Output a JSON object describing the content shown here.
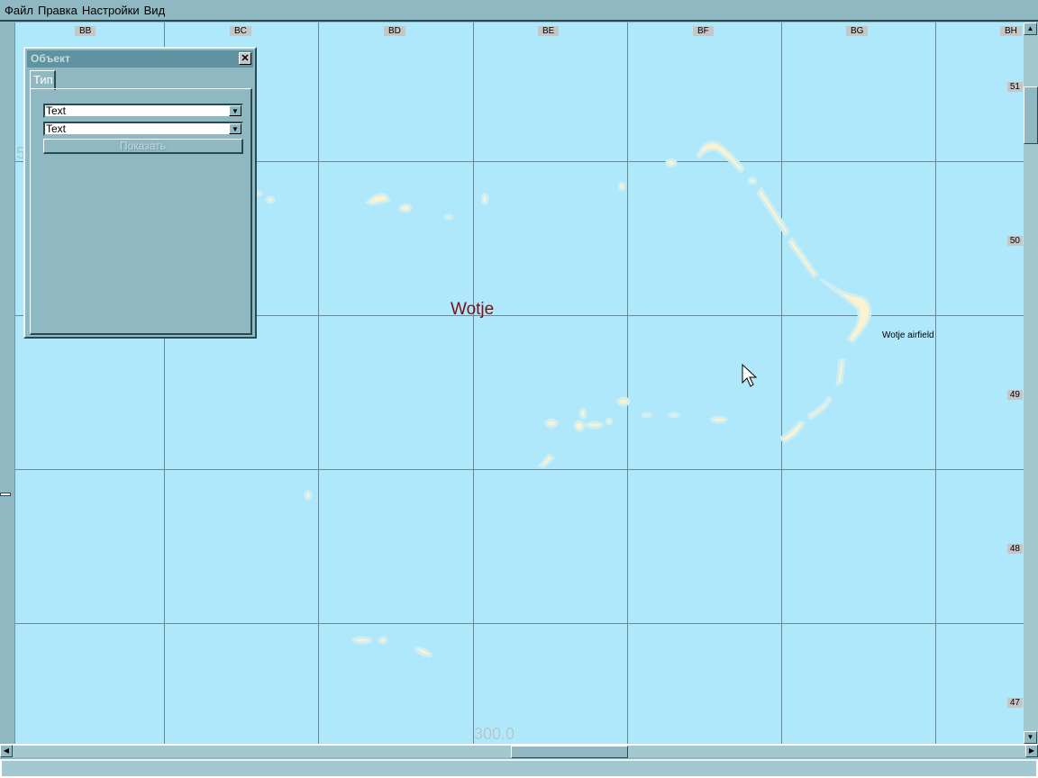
{
  "menu": [
    "Файл",
    "Правка",
    "Настройки",
    "Вид"
  ],
  "map": {
    "columns": [
      "BB",
      "BC",
      "BD",
      "BE",
      "BF",
      "BG",
      "BH"
    ],
    "rows": [
      "51",
      "50",
      "49",
      "48",
      "47"
    ],
    "labels": {
      "atoll": "Wotje",
      "airfield": "Wotje airfield",
      "scale": "300.0",
      "edge_digit": "5"
    }
  },
  "dialog": {
    "title": "Объект",
    "close": "✕",
    "tab": "Тип",
    "select1": "Text",
    "select2": "Text",
    "show_button": "Показать"
  },
  "colors": {
    "water": "#aee8fa",
    "land": "#fbf3cf",
    "chrome": "#8fb8c2"
  }
}
